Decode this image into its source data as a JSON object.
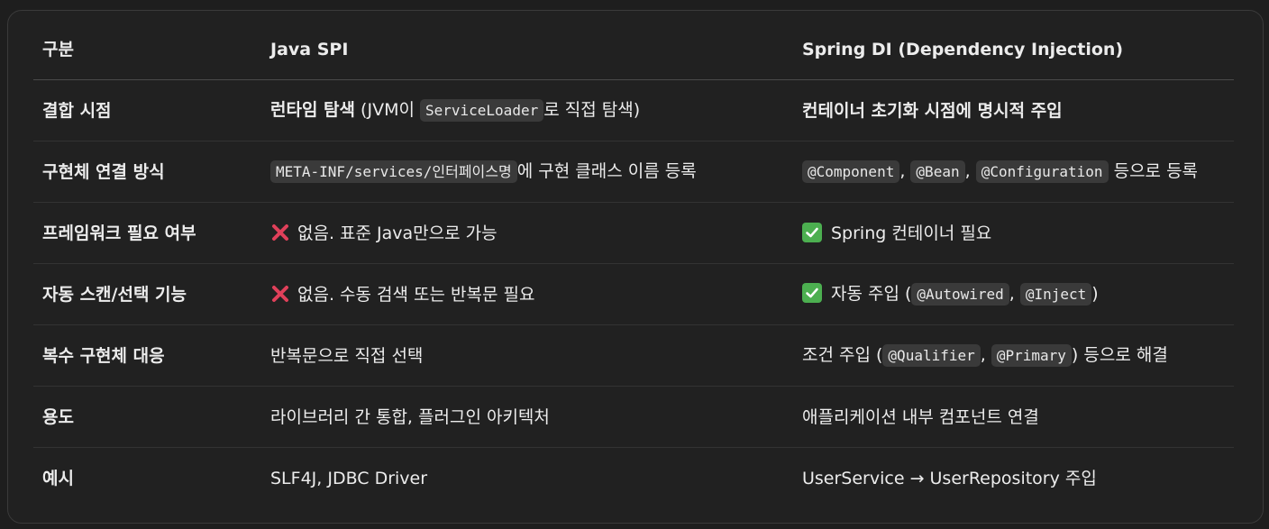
{
  "table": {
    "headers": [
      "구분",
      "Java SPI",
      "Spring DI (Dependency Injection)"
    ],
    "rows": [
      {
        "label": "결합 시점",
        "spi": {
          "strong": "런타임 탐색",
          "pre": " (JVM이 ",
          "code": "ServiceLoader",
          "post": "로 직접 탐색)"
        },
        "di": "컨테이너 초기화 시점에 명시적 주입"
      },
      {
        "label": "구현체 연결 방식",
        "spi": {
          "code": "META-INF/services/인터페이스명",
          "post": "에 구현 클래스 이름 등록"
        },
        "di": {
          "code1": "@Component",
          "sep1": ", ",
          "code2": "@Bean",
          "sep2": ", ",
          "code3": "@Configuration",
          "post": " 등으로 등록"
        }
      },
      {
        "label": "프레임워크 필요 여부",
        "spi": {
          "icon": "cross-mark-icon",
          "text": "없음. 표준 Java만으로 가능"
        },
        "di": {
          "icon": "check-mark-icon",
          "text": "Spring 컨테이너 필요"
        }
      },
      {
        "label": "자동 스캔/선택 기능",
        "spi": {
          "icon": "cross-mark-icon",
          "text": "없음. 수동 검색 또는 반복문 필요"
        },
        "di": {
          "icon": "check-mark-icon",
          "pre": "자동 주입 (",
          "code1": "@Autowired",
          "sep": ", ",
          "code2": "@Inject",
          "post": ")"
        }
      },
      {
        "label": "복수 구현체 대응",
        "spi": "반복문으로 직접 선택",
        "di": {
          "pre": "조건 주입 (",
          "code1": "@Qualifier",
          "sep": ", ",
          "code2": "@Primary",
          "post": ") 등으로 해결"
        }
      },
      {
        "label": "용도",
        "spi": "라이브러리 간 통합, 플러그인 아키텍처",
        "di": "애플리케이션 내부 컴포넌트 연결"
      },
      {
        "label": "예시",
        "spi": "SLF4J, JDBC Driver",
        "di": "UserService → UserRepository 주입"
      }
    ]
  },
  "colors": {
    "background": "#212121",
    "cross": "#e0405a",
    "check": "#4caf50"
  }
}
